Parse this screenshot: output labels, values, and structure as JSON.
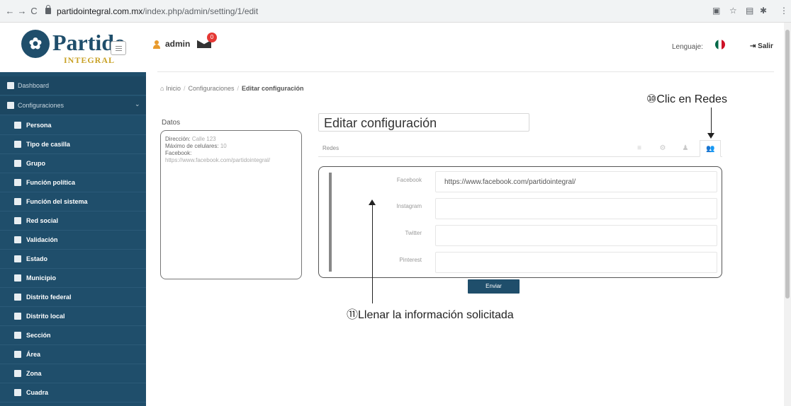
{
  "browser": {
    "back": "←",
    "forward": "→",
    "reload": "C",
    "url_host": "partidointegral.com.mx",
    "url_path": "/index.php/admin/setting/1/edit"
  },
  "logo": {
    "word": "Partido",
    "sub": "INTEGRAL"
  },
  "header": {
    "username": "admin",
    "mail_count": "0",
    "language_label": "Lenguaje:",
    "logout_label": "Salir"
  },
  "sidebar": {
    "items": [
      {
        "label": "Dashboard",
        "icon": "dashboard-icon"
      },
      {
        "label": "Configuraciones",
        "icon": "gear-icon"
      },
      {
        "label": "Persona",
        "icon": "user-icon"
      },
      {
        "label": "Tipo de casilla",
        "icon": "file-icon"
      },
      {
        "label": "Grupo",
        "icon": "group-icon"
      },
      {
        "label": "Función política",
        "icon": "edit-icon"
      },
      {
        "label": "Función del sistema",
        "icon": "bookmark-icon"
      },
      {
        "label": "Red social",
        "icon": "facebook-icon"
      },
      {
        "label": "Validación",
        "icon": "check-icon"
      },
      {
        "label": "Estado",
        "icon": "map-icon"
      },
      {
        "label": "Municipio",
        "icon": "map-icon"
      },
      {
        "label": "Distrito federal",
        "icon": "map-icon"
      },
      {
        "label": "Distrito local",
        "icon": "map-icon"
      },
      {
        "label": "Sección",
        "icon": "map-icon"
      },
      {
        "label": "Área",
        "icon": "map-icon"
      },
      {
        "label": "Zona",
        "icon": "map-icon"
      },
      {
        "label": "Cuadra",
        "icon": "map-icon"
      }
    ]
  },
  "breadcrumb": {
    "home": "Inicio",
    "section": "Configuraciones",
    "current": "Editar configuración"
  },
  "annotations": {
    "step10": "⑩Clic en Redes",
    "step11": "⑪Llenar la información solicitada"
  },
  "datos": {
    "title": "Datos",
    "direccion_label": "Dirección:",
    "direccion_value": "Calle 123",
    "maximo_label": "Máximo de celulares:",
    "maximo_value": "10",
    "facebook_label": "Facebook:",
    "facebook_value": "https://www.facebook.com/partidointegral/"
  },
  "editor": {
    "title": "Editar configuración",
    "tab_label": "Redes",
    "fields": [
      {
        "label": "Facebook",
        "value": "https://www.facebook.com/partidointegral/"
      },
      {
        "label": "Instagram",
        "value": ""
      },
      {
        "label": "Twitter",
        "value": ""
      },
      {
        "label": "Pinterest",
        "value": ""
      }
    ],
    "submit_label": "Enviar"
  },
  "colors": {
    "sidebar": "#1f4e6b",
    "accent_gold": "#c9a227",
    "badge": "#e53935"
  }
}
